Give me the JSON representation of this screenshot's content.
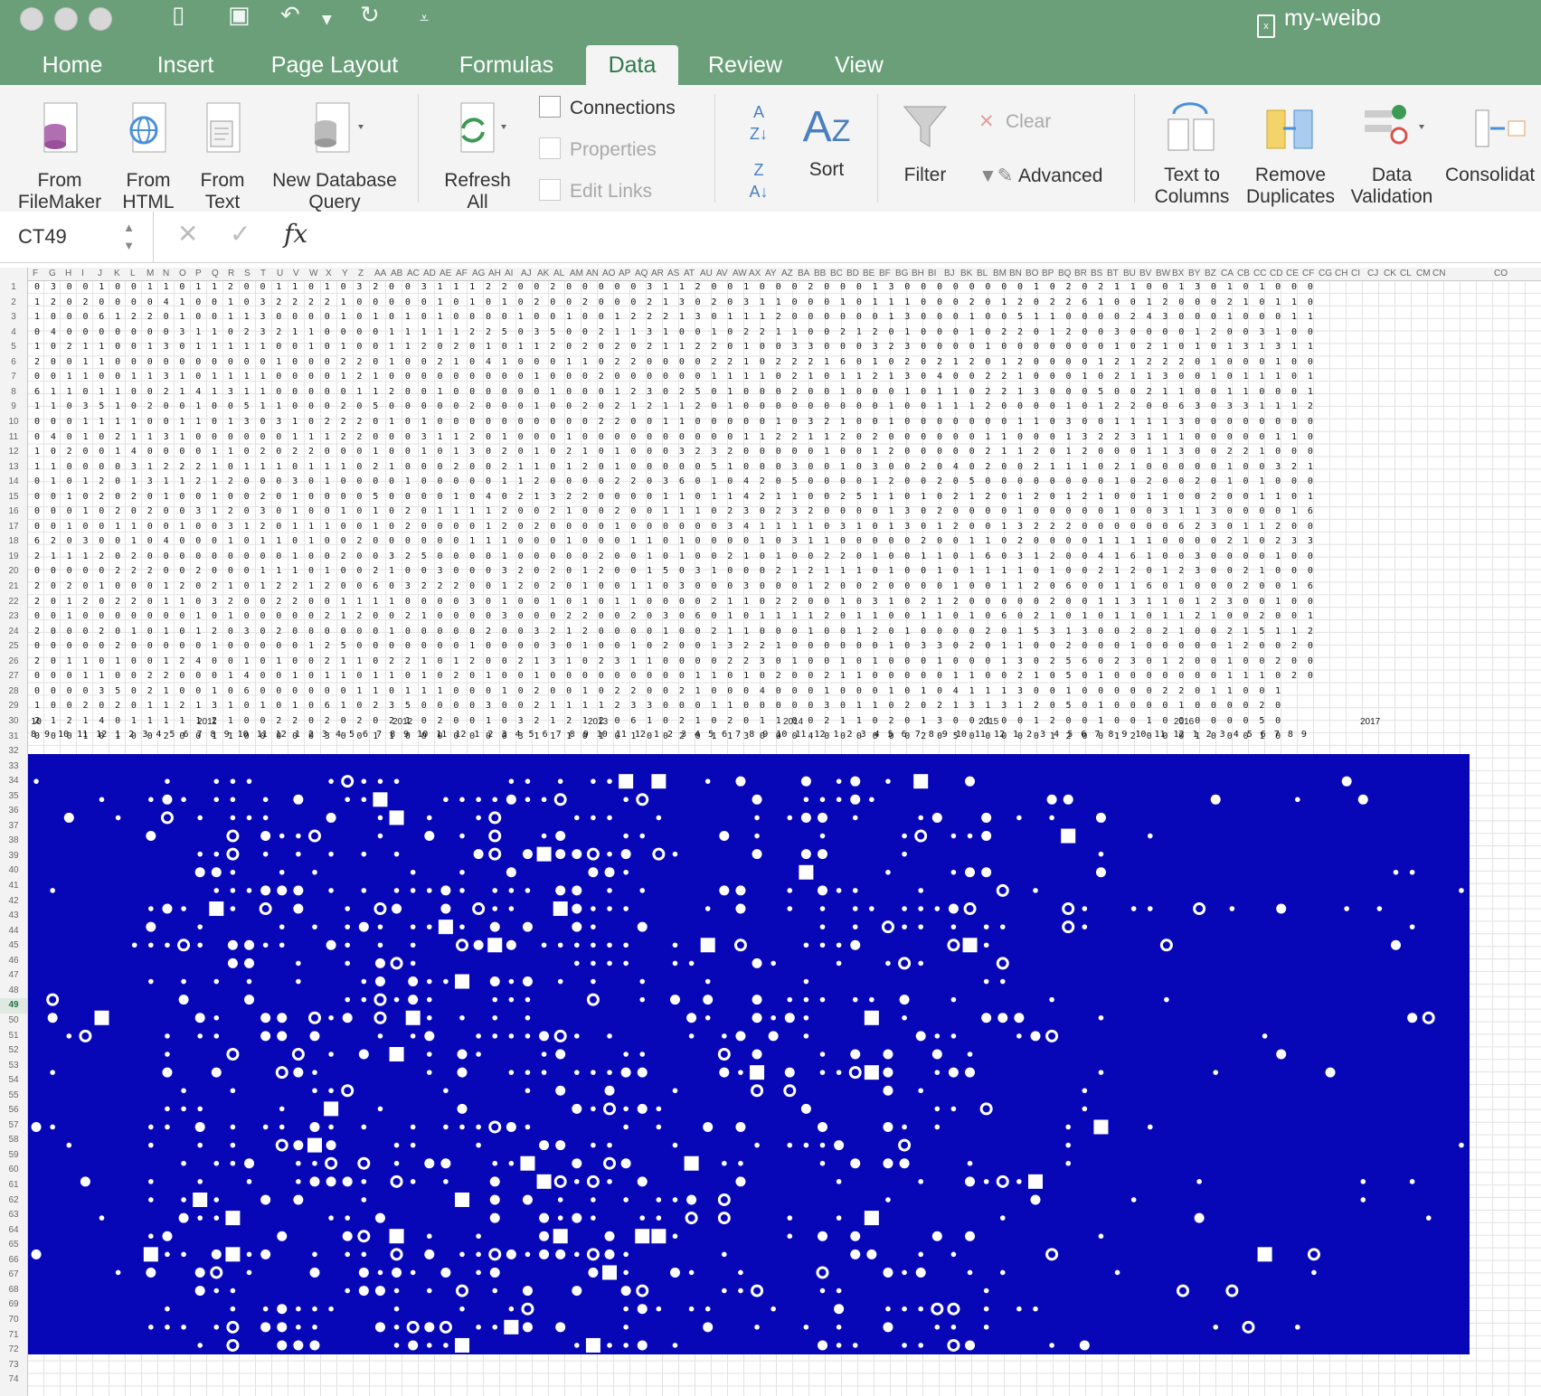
{
  "window": {
    "title": "my-weibo"
  },
  "tabs": [
    {
      "label": "Home",
      "active": false
    },
    {
      "label": "Insert",
      "active": false
    },
    {
      "label": "Page Layout",
      "active": false
    },
    {
      "label": "Formulas",
      "active": false
    },
    {
      "label": "Data",
      "active": true
    },
    {
      "label": "Review",
      "active": false
    },
    {
      "label": "View",
      "active": false
    }
  ],
  "ribbon": {
    "from_filemaker": "From\nFileMaker",
    "from_html": "From\nHTML",
    "from_text": "From\nText",
    "new_db_query": "New Database\nQuery",
    "refresh_all": "Refresh\nAll",
    "connections": "Connections",
    "properties": "Properties",
    "edit_links": "Edit Links",
    "sort": "Sort",
    "filter": "Filter",
    "clear": "Clear",
    "advanced": "Advanced",
    "text_to_columns": "Text to\nColumns",
    "remove_duplicates": "Remove\nDuplicates",
    "data_validation": "Data\nValidation",
    "consolidate": "Consolidat"
  },
  "formula_bar": {
    "name_box": "CT49",
    "fx": "fx",
    "value": ""
  },
  "sheet": {
    "selected_row": 49,
    "rows_visible": 74,
    "column_headers": [
      "F",
      "G",
      "H",
      "I",
      "J",
      "K",
      "L",
      "M",
      "N",
      "O",
      "P",
      "Q",
      "R",
      "S",
      "T",
      "U",
      "V",
      "W",
      "X",
      "Y",
      "Z",
      "AA",
      "AB",
      "AC",
      "AD",
      "AE",
      "AF",
      "AG",
      "AH",
      "AI",
      "AJ",
      "AK",
      "AL",
      "AM",
      "AN",
      "AO",
      "AP",
      "AQ",
      "AR",
      "AS",
      "AT",
      "AU",
      "AV",
      "AW",
      "AX",
      "AY",
      "AZ",
      "BA",
      "BB",
      "BC",
      "BD",
      "BE",
      "BF",
      "BG",
      "BH",
      "BI",
      "BJ",
      "BK",
      "BL",
      "BM",
      "BN",
      "BO",
      "BP",
      "BQ",
      "BR",
      "BS",
      "BT",
      "BU",
      "BV",
      "BW",
      "BX",
      "BY",
      "BZ",
      "CA",
      "CB",
      "CC",
      "CD",
      "CE",
      "CF",
      "CG",
      "CH",
      "CI",
      "CJ",
      "CK",
      "CL",
      "CM",
      "CN",
      "CO"
    ],
    "years": [
      "2011",
      "2012",
      "2013",
      "2014",
      "2015",
      "2016",
      "2017"
    ],
    "month_row": "8 9 10 11 12 1 2 3 4 5 6 7 8 9 10 11 12 1 2 3 4 5 6 7 8 9 10 11 12 1 2 3 4 5 6 7 8 9 10 11 12 1 2 3 4 5 6 7 8 9 10 11 12 1 2 3 4 5 6 7 8 9 10 11 12 1 2 3 4 5 6 7 8 9 10 11 12 1 2 3 4 5 6 7 8 9",
    "row35_first": "10"
  },
  "colors": {
    "titlebar": "#6a9f7a",
    "plot_bg": "#0707b7",
    "plot_marks": "#ffffff",
    "accent": "#217346"
  }
}
